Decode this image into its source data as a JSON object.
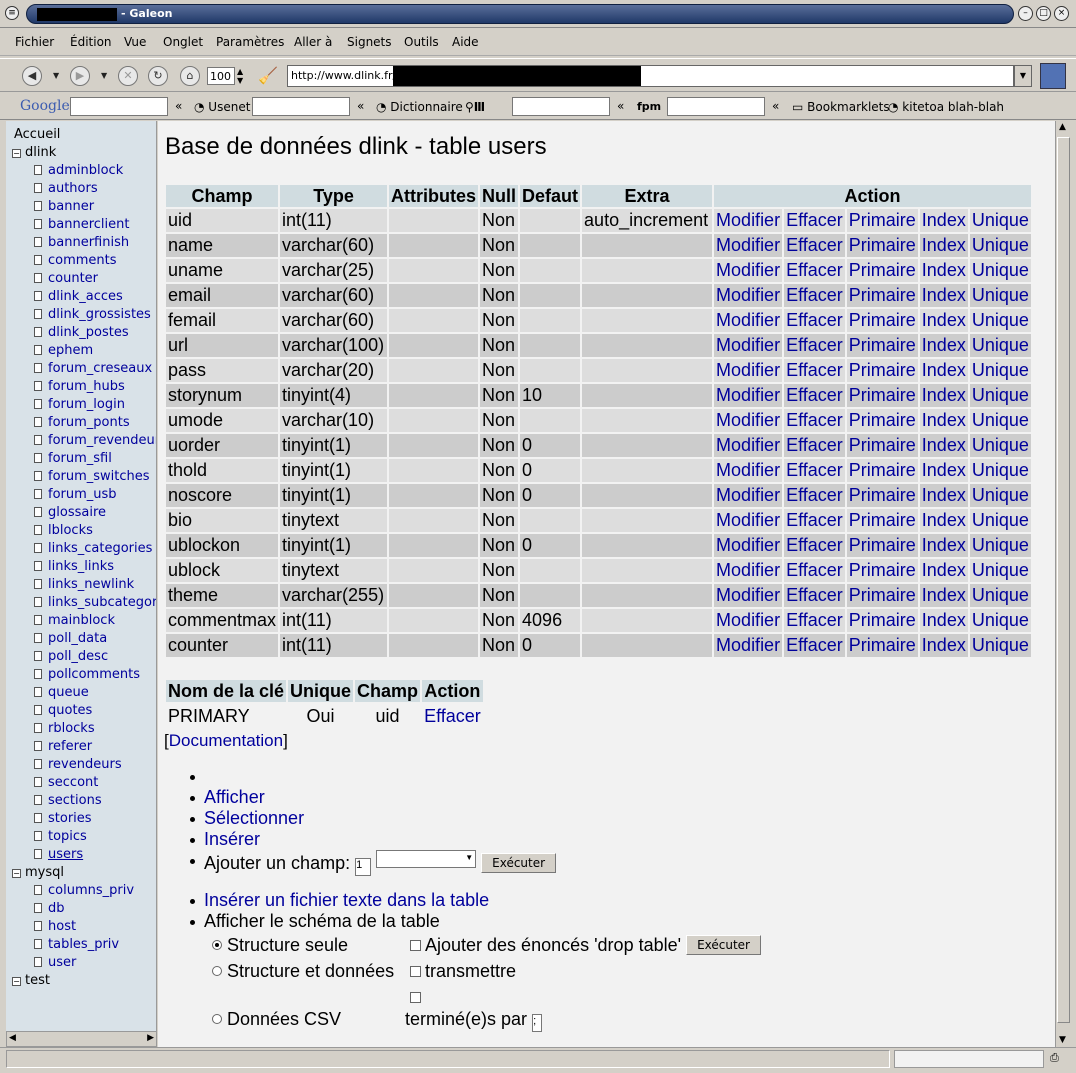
{
  "window": {
    "title": "- Galeon"
  },
  "menubar": [
    "Fichier",
    "Édition",
    "Vue",
    "Onglet",
    "Paramètres",
    "Aller à",
    "Signets",
    "Outils",
    "Aide"
  ],
  "toolbar": {
    "zoom": "100",
    "url": "http://www.dlink.fr/"
  },
  "searchbar": {
    "google": "Google",
    "usenet": "Usenet",
    "dictionnaire": "Dictionnaire",
    "fpm": "fpm",
    "bookmarklets": "Bookmarklets",
    "kitetoa": "kitetoa blah-blah"
  },
  "sidebar": {
    "root": "Accueil",
    "dlink": {
      "label": "dlink",
      "tables": [
        "adminblock",
        "authors",
        "banner",
        "bannerclient",
        "bannerfinish",
        "comments",
        "counter",
        "dlink_acces",
        "dlink_grossistes",
        "dlink_postes",
        "ephem",
        "forum_creseaux",
        "forum_hubs",
        "forum_login",
        "forum_ponts",
        "forum_revendeurs",
        "forum_sfil",
        "forum_switches",
        "forum_usb",
        "glossaire",
        "lblocks",
        "links_categories",
        "links_links",
        "links_newlink",
        "links_subcategories",
        "mainblock",
        "poll_data",
        "poll_desc",
        "pollcomments",
        "queue",
        "quotes",
        "rblocks",
        "referer",
        "revendeurs",
        "seccont",
        "sections",
        "stories",
        "topics",
        "users"
      ]
    },
    "mysql": {
      "label": "mysql",
      "tables": [
        "columns_priv",
        "db",
        "host",
        "tables_priv",
        "user"
      ]
    },
    "test": {
      "label": "test"
    }
  },
  "main": {
    "title": "Base de données dlink - table users",
    "headers": [
      "Champ",
      "Type",
      "Attributes",
      "Null",
      "Defaut",
      "Extra",
      "Action"
    ],
    "actions": [
      "Modifier",
      "Effacer",
      "Primaire",
      "Index",
      "Unique"
    ],
    "rows": [
      [
        "uid",
        "int(11)",
        "",
        "Non",
        "",
        "auto_increment"
      ],
      [
        "name",
        "varchar(60)",
        "",
        "Non",
        "",
        ""
      ],
      [
        "uname",
        "varchar(25)",
        "",
        "Non",
        "",
        ""
      ],
      [
        "email",
        "varchar(60)",
        "",
        "Non",
        "",
        ""
      ],
      [
        "femail",
        "varchar(60)",
        "",
        "Non",
        "",
        ""
      ],
      [
        "url",
        "varchar(100)",
        "",
        "Non",
        "",
        ""
      ],
      [
        "pass",
        "varchar(20)",
        "",
        "Non",
        "",
        ""
      ],
      [
        "storynum",
        "tinyint(4)",
        "",
        "Non",
        "10",
        ""
      ],
      [
        "umode",
        "varchar(10)",
        "",
        "Non",
        "",
        ""
      ],
      [
        "uorder",
        "tinyint(1)",
        "",
        "Non",
        "0",
        ""
      ],
      [
        "thold",
        "tinyint(1)",
        "",
        "Non",
        "0",
        ""
      ],
      [
        "noscore",
        "tinyint(1)",
        "",
        "Non",
        "0",
        ""
      ],
      [
        "bio",
        "tinytext",
        "",
        "Non",
        "",
        ""
      ],
      [
        "ublockon",
        "tinyint(1)",
        "",
        "Non",
        "0",
        ""
      ],
      [
        "ublock",
        "tinytext",
        "",
        "Non",
        "",
        ""
      ],
      [
        "theme",
        "varchar(255)",
        "",
        "Non",
        "",
        ""
      ],
      [
        "commentmax",
        "int(11)",
        "",
        "Non",
        "4096",
        ""
      ],
      [
        "counter",
        "int(11)",
        "",
        "Non",
        "0",
        ""
      ]
    ],
    "keys": {
      "headers": [
        "Nom de la clé",
        "Unique",
        "Champ",
        "Action"
      ],
      "rows": [
        [
          "PRIMARY",
          "Oui",
          "uid",
          "Effacer"
        ]
      ]
    },
    "documentation": "Documentation",
    "ops": {
      "afficher": "Afficher",
      "selectionner": "Sélectionner",
      "inserer": "Insérer",
      "ajouter": "Ajouter un champ:",
      "ajouter_value": "1",
      "executer": "Exécuter",
      "inserer_fichier": "Insérer un fichier texte dans la table",
      "schema": "Afficher le schéma de la table"
    },
    "schema": {
      "structure_seule": "Structure seule",
      "structure_donnees": "Structure et données",
      "donnees_csv": "Données CSV",
      "drop": "Ajouter des énoncés 'drop table'",
      "transmettre": "transmettre",
      "termine": "terminé(e)s par",
      "termine_value": ";"
    }
  }
}
